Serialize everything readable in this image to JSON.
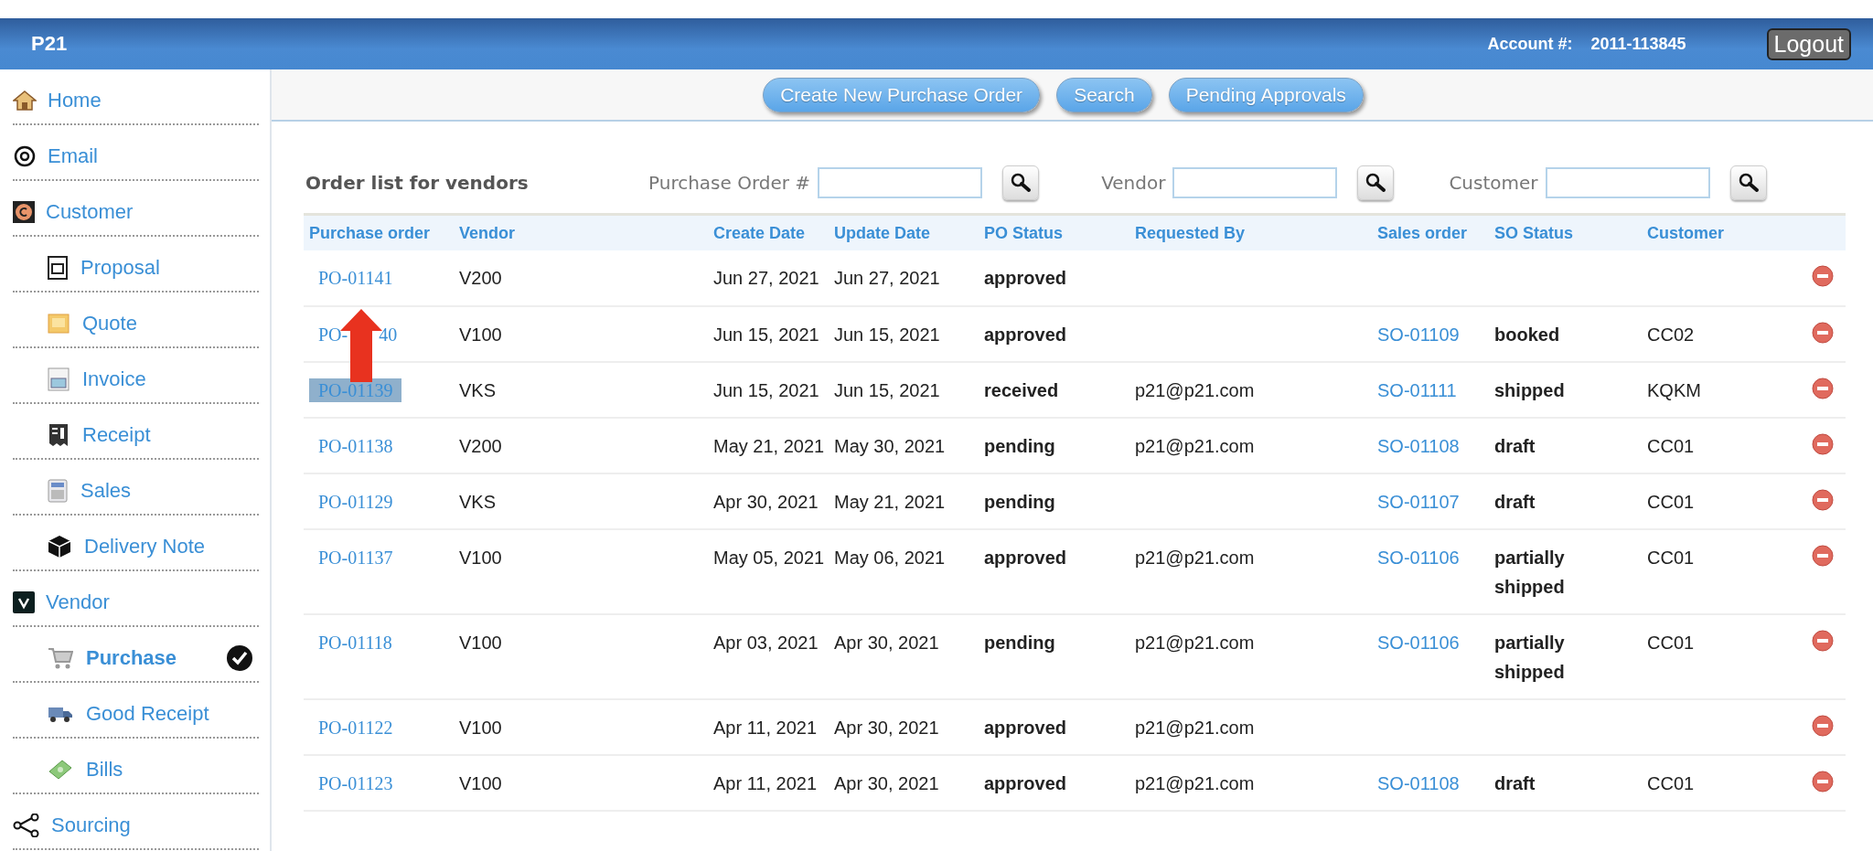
{
  "header": {
    "title": "P21",
    "account_label": "Account #:",
    "account_number": "2011-113845",
    "logout": "Logout"
  },
  "sidebar": {
    "items": [
      {
        "label": "Home",
        "kind": "top",
        "selected": false
      },
      {
        "label": "Email",
        "kind": "top",
        "selected": false
      },
      {
        "label": "Customer",
        "kind": "top",
        "selected": false
      },
      {
        "label": "Proposal",
        "kind": "sub",
        "selected": false
      },
      {
        "label": "Quote",
        "kind": "sub",
        "selected": false
      },
      {
        "label": "Invoice",
        "kind": "sub",
        "selected": false
      },
      {
        "label": "Receipt",
        "kind": "sub",
        "selected": false
      },
      {
        "label": "Sales",
        "kind": "sub",
        "selected": false
      },
      {
        "label": "Delivery Note",
        "kind": "sub",
        "selected": false
      },
      {
        "label": "Vendor",
        "kind": "top",
        "selected": false
      },
      {
        "label": "Purchase",
        "kind": "sub",
        "selected": true
      },
      {
        "label": "Good Receipt",
        "kind": "sub",
        "selected": false
      },
      {
        "label": "Bills",
        "kind": "sub",
        "selected": false
      },
      {
        "label": "Sourcing",
        "kind": "top",
        "selected": false
      }
    ]
  },
  "toolbar": {
    "buttons": [
      "Create New Purchase Order",
      "Search",
      "Pending Approvals"
    ]
  },
  "filters": {
    "title": "Order list for vendors",
    "fields": [
      {
        "label": "Purchase Order #"
      },
      {
        "label": "Vendor"
      },
      {
        "label": "Customer"
      }
    ]
  },
  "table": {
    "columns": [
      "Purchase order",
      "Vendor",
      "Create Date",
      "Update Date",
      "PO Status",
      "Requested By",
      "Sales order",
      "SO Status",
      "Customer"
    ],
    "rows": [
      {
        "purchase_order": "PO-01141",
        "highlighted": false,
        "vendor": "V200",
        "create_date": "Jun 27, 2021",
        "update_date": "Jun 27, 2021",
        "po_status": "approved",
        "requested_by": "",
        "sales_order": "",
        "so_status": "",
        "customer": ""
      },
      {
        "purchase_order": "PO-",
        "purchase_order_tail": "40",
        "highlighted": false,
        "vendor": "V100",
        "create_date": "Jun 15, 2021",
        "update_date": "Jun 15, 2021",
        "po_status": "approved",
        "requested_by": "",
        "sales_order": "SO-01109",
        "so_status": "booked",
        "customer": "CC02"
      },
      {
        "purchase_order": "PO-01139",
        "highlighted": true,
        "vendor": "VKS",
        "create_date": "Jun 15, 2021",
        "update_date": "Jun 15, 2021",
        "po_status": "received",
        "requested_by": "p21@p21.com",
        "sales_order": "SO-01111",
        "so_status": "shipped",
        "customer": "KQKM"
      },
      {
        "purchase_order": "PO-01138",
        "highlighted": false,
        "vendor": "V200",
        "create_date": "May 21, 2021",
        "update_date": "May 30, 2021",
        "po_status": "pending",
        "requested_by": "p21@p21.com",
        "sales_order": "SO-01108",
        "so_status": "draft",
        "customer": "CC01"
      },
      {
        "purchase_order": "PO-01129",
        "highlighted": false,
        "vendor": "VKS",
        "create_date": "Apr 30, 2021",
        "update_date": "May 21, 2021",
        "po_status": "pending",
        "requested_by": "",
        "sales_order": "SO-01107",
        "so_status": "draft",
        "customer": "CC01"
      },
      {
        "purchase_order": "PO-01137",
        "highlighted": false,
        "vendor": "V100",
        "create_date": "May 05, 2021",
        "update_date": "May 06, 2021",
        "po_status": "approved",
        "requested_by": "p21@p21.com",
        "sales_order": "SO-01106",
        "so_status": "partially shipped",
        "customer": "CC01"
      },
      {
        "purchase_order": "PO-01118",
        "highlighted": false,
        "vendor": "V100",
        "create_date": "Apr 03, 2021",
        "update_date": "Apr 30, 2021",
        "po_status": "pending",
        "requested_by": "p21@p21.com",
        "sales_order": "SO-01106",
        "so_status": "partially shipped",
        "customer": "CC01"
      },
      {
        "purchase_order": "PO-01122",
        "highlighted": false,
        "vendor": "V100",
        "create_date": "Apr 11, 2021",
        "update_date": "Apr 30, 2021",
        "po_status": "approved",
        "requested_by": "p21@p21.com",
        "sales_order": "",
        "so_status": "",
        "customer": ""
      },
      {
        "purchase_order": "PO-01123",
        "highlighted": false,
        "vendor": "V100",
        "create_date": "Apr 11, 2021",
        "update_date": "Apr 30, 2021",
        "po_status": "approved",
        "requested_by": "p21@p21.com",
        "sales_order": "SO-01108",
        "so_status": "draft",
        "customer": "CC01"
      }
    ]
  },
  "annotation": {
    "kind": "arrow"
  }
}
